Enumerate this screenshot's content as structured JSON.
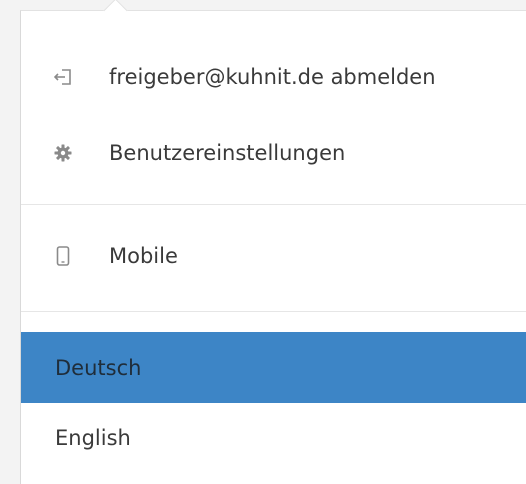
{
  "menu": {
    "logout_label": "freigeber@kuhnit.de abmelden",
    "settings_label": "Benutzereinstellungen",
    "mobile_label": "Mobile",
    "icons": {
      "logout": "logout-icon",
      "settings": "gear-icon",
      "mobile": "mobile-phone-icon"
    }
  },
  "languages": [
    {
      "label": "Deutsch",
      "selected": true
    },
    {
      "label": "English",
      "selected": false
    }
  ],
  "colors": {
    "selected_bg": "#3d85c6",
    "icon_gray": "#8a8a8a",
    "text": "#3a3a3a"
  }
}
